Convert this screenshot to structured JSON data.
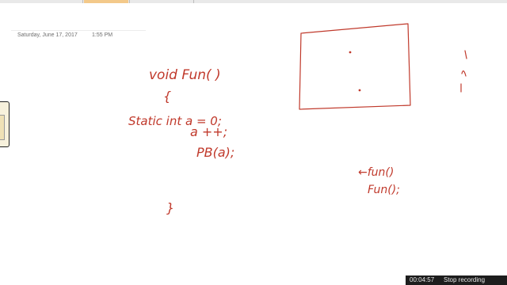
{
  "page": {
    "date": "Saturday, June 17, 2017",
    "time": "1:55 PM"
  },
  "ink": {
    "color": "#c0392b",
    "lines": [
      "void  Fun( )",
      "{",
      "Static int a = 0;",
      "a ++;",
      "PB(a);",
      "}",
      "←fun()",
      "Fun();"
    ]
  },
  "recording": {
    "elapsed": "00:04:57",
    "stop_label": "Stop recording"
  }
}
